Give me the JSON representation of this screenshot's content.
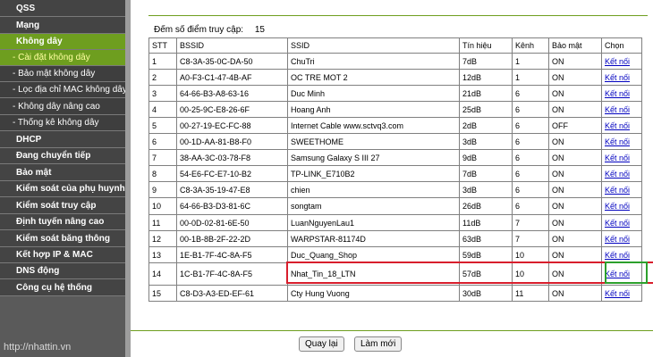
{
  "sidebar": {
    "items": [
      {
        "label": "QSS",
        "type": "main",
        "active": false
      },
      {
        "label": "Mạng",
        "type": "main",
        "active": false
      },
      {
        "label": "Không dây",
        "type": "main",
        "active": true
      },
      {
        "label": "- Cài đặt không dây",
        "type": "sub",
        "active": true
      },
      {
        "label": "- Bảo mật không dây",
        "type": "sub",
        "active": false
      },
      {
        "label": "- Lọc địa chỉ MAC không dây",
        "type": "sub",
        "active": false
      },
      {
        "label": "- Không dây nâng cao",
        "type": "sub",
        "active": false
      },
      {
        "label": "- Thống kê không dây",
        "type": "sub",
        "active": false
      },
      {
        "label": "DHCP",
        "type": "main",
        "active": false
      },
      {
        "label": "Đang chuyển tiếp",
        "type": "main",
        "active": false
      },
      {
        "label": "Bảo mật",
        "type": "main",
        "active": false
      },
      {
        "label": "Kiểm soát của phụ huynh",
        "type": "main",
        "active": false
      },
      {
        "label": "Kiểm soát truy cập",
        "type": "main",
        "active": false
      },
      {
        "label": "Định tuyến nâng cao",
        "type": "main",
        "active": false
      },
      {
        "label": "Kiểm soát băng thông",
        "type": "main",
        "active": false
      },
      {
        "label": "Kết hợp IP & MAC",
        "type": "main",
        "active": false
      },
      {
        "label": "DNS động",
        "type": "main",
        "active": false
      },
      {
        "label": "Công cụ hệ thống",
        "type": "main",
        "active": false
      }
    ],
    "watermark": "http://nhattin.vn"
  },
  "count": {
    "label": "Đếm số điểm truy cập:",
    "value": "15"
  },
  "table": {
    "headers": [
      "STT",
      "BSSID",
      "SSID",
      "Tín hiệu",
      "Kênh",
      "Bảo mật",
      "Chọn"
    ],
    "rows": [
      [
        "1",
        "C8-3A-35-0C-DA-50",
        "ChuTri",
        "7dB",
        "1",
        "ON",
        "Kết nối"
      ],
      [
        "2",
        "A0-F3-C1-47-4B-AF",
        "OC TRE MOT 2",
        "12dB",
        "1",
        "ON",
        "Kết nối"
      ],
      [
        "3",
        "64-66-B3-A8-63-16",
        "Duc Minh",
        "21dB",
        "6",
        "ON",
        "Kết nối"
      ],
      [
        "4",
        "00-25-9C-E8-26-6F",
        "Hoang Anh",
        "25dB",
        "6",
        "ON",
        "Kết nối"
      ],
      [
        "5",
        "00-27-19-EC-FC-88",
        "Internet Cable www.sctvq3.com",
        "2dB",
        "6",
        "OFF",
        "Kết nối"
      ],
      [
        "6",
        "00-1D-AA-81-B8-F0",
        "SWEETHOME",
        "3dB",
        "6",
        "ON",
        "Kết nối"
      ],
      [
        "7",
        "38-AA-3C-03-78-F8",
        "Samsung Galaxy S III 27",
        "9dB",
        "6",
        "ON",
        "Kết nối"
      ],
      [
        "8",
        "54-E6-FC-E7-10-B2",
        "TP-LINK_E710B2",
        "7dB",
        "6",
        "ON",
        "Kết nối"
      ],
      [
        "9",
        "C8-3A-35-19-47-E8",
        "chien",
        "3dB",
        "6",
        "ON",
        "Kết nối"
      ],
      [
        "10",
        "64-66-B3-D3-81-6C",
        "songtam",
        "26dB",
        "6",
        "ON",
        "Kết nối"
      ],
      [
        "11",
        "00-0D-02-81-6E-50",
        "LuanNguyenLau1",
        "11dB",
        "7",
        "ON",
        "Kết nối"
      ],
      [
        "12",
        "00-1B-8B-2F-22-2D",
        "WARPSTAR-81174D",
        "63dB",
        "7",
        "ON",
        "Kết nối"
      ],
      [
        "13",
        "1E-B1-7F-4C-8A-F5",
        "Duc_Quang_Shop",
        "59dB",
        "10",
        "ON",
        "Kết nối"
      ],
      [
        "14",
        "1C-B1-7F-4C-8A-F5",
        "Nhat_Tin_18_LTN",
        "57dB",
        "10",
        "ON",
        "Kết nối"
      ],
      [
        "15",
        "C8-D3-A3-ED-EF-61",
        "Cty Hung Vuong",
        "30dB",
        "11",
        "ON",
        "Kết nối"
      ]
    ]
  },
  "buttons": {
    "back": "Quay lại",
    "refresh": "Làm mới"
  },
  "colors": {
    "accent": "#6e9e1f",
    "highlight_red": "#d81e2c",
    "highlight_green": "#2ca02c"
  }
}
